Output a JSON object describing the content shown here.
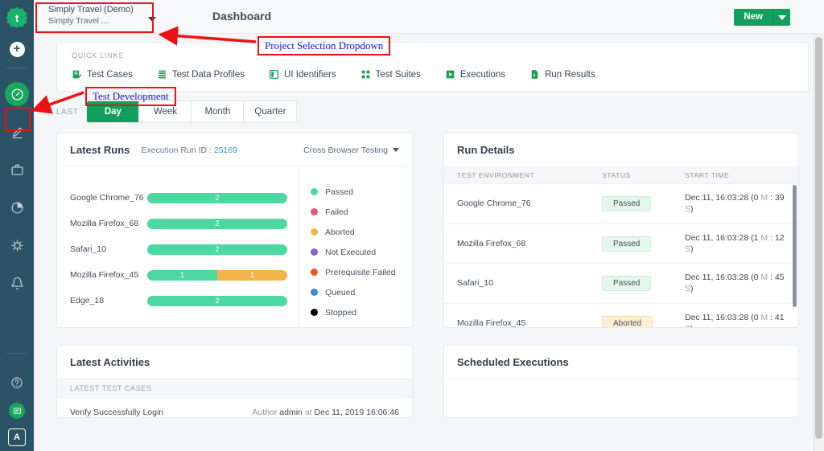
{
  "rail": {
    "logo_icon": "gear-logo-icon",
    "logo_letter": "t",
    "add_icon": "plus-icon",
    "items": [
      {
        "icon": "speedometer-dashboard-icon",
        "name": "dashboard",
        "active": true
      },
      {
        "icon": "pencil-edit-icon",
        "name": "test-development",
        "active": false
      },
      {
        "icon": "briefcase-icon",
        "name": "test-lab",
        "active": false
      },
      {
        "icon": "pie-chart-icon",
        "name": "reports",
        "active": false
      },
      {
        "icon": "bug-settings-icon",
        "name": "defects",
        "active": false
      },
      {
        "icon": "bell-icon",
        "name": "notifications",
        "active": false
      }
    ],
    "bottom": [
      {
        "icon": "help-question-icon",
        "name": "help"
      },
      {
        "icon": "chat-message-icon",
        "name": "messages"
      }
    ],
    "avatar_letter": "A"
  },
  "topbar": {
    "project_name": "Simply Travel (Demo)",
    "project_sub": "Simply Travel ...",
    "caret_icon": "chevron-down-icon",
    "page_title": "Dashboard",
    "new_label": "New",
    "new_caret_icon": "chevron-down-icon"
  },
  "quick_links": {
    "title": "QUICK LINKS",
    "items": [
      {
        "label": "Test Cases",
        "icon": "test-cases-icon"
      },
      {
        "label": "Test Data Profiles",
        "icon": "test-data-profiles-icon"
      },
      {
        "label": "UI Identifiers",
        "icon": "ui-identifiers-icon"
      },
      {
        "label": "Test Suites",
        "icon": "test-suites-icon"
      },
      {
        "label": "Executions",
        "icon": "executions-icon"
      },
      {
        "label": "Run Results",
        "icon": "run-results-icon"
      }
    ]
  },
  "period": {
    "label": "LAST",
    "options": [
      "Day",
      "Week",
      "Month",
      "Quarter"
    ],
    "selected": "Day"
  },
  "latest_runs": {
    "title": "Latest Runs",
    "run_id_label": "Execution Run ID :",
    "run_id_value": "25169",
    "filter_label": "Cross Browser Testing",
    "filter_caret_icon": "chevron-down-icon",
    "legend": [
      {
        "label": "Passed",
        "color": "#4CD8A0"
      },
      {
        "label": "Failed",
        "color": "#E4566E"
      },
      {
        "label": "Aborted",
        "color": "#F0B44A"
      },
      {
        "label": "Not Executed",
        "color": "#8761D6"
      },
      {
        "label": "Prerequisite Failed",
        "color": "#F4511E"
      },
      {
        "label": "Queued",
        "color": "#3B8EDE"
      },
      {
        "label": "Stopped",
        "color": "#000000"
      }
    ]
  },
  "chart_data": {
    "type": "bar",
    "title": "Latest Runs",
    "orientation": "horizontal",
    "stacked": true,
    "categories": [
      "Google Chrome_76",
      "Mozilla Firefox_68",
      "Safari_10",
      "Mozilla Firefox_45",
      "Edge_18"
    ],
    "series": [
      {
        "name": "Passed",
        "color": "#4CD8A0",
        "values": [
          2,
          2,
          2,
          1,
          2
        ]
      },
      {
        "name": "Failed",
        "color": "#E4566E",
        "values": [
          0,
          0,
          0,
          0,
          0
        ]
      },
      {
        "name": "Aborted",
        "color": "#F0B44A",
        "values": [
          0,
          0,
          0,
          1,
          0
        ]
      },
      {
        "name": "Not Executed",
        "color": "#8761D6",
        "values": [
          0,
          0,
          0,
          0,
          0
        ]
      },
      {
        "name": "Prerequisite Failed",
        "color": "#F4511E",
        "values": [
          0,
          0,
          0,
          0,
          0
        ]
      },
      {
        "name": "Queued",
        "color": "#3B8EDE",
        "values": [
          0,
          0,
          0,
          0,
          0
        ]
      },
      {
        "name": "Stopped",
        "color": "#000000",
        "values": [
          0,
          0,
          0,
          0,
          0
        ]
      }
    ],
    "totals": [
      2,
      2,
      2,
      2,
      2
    ],
    "xlabel": "",
    "ylabel": "",
    "legend_position": "right",
    "grid": false
  },
  "run_details": {
    "title": "Run Details",
    "columns": [
      "TEST ENVIRONMENT",
      "STATUS",
      "START TIME"
    ],
    "rows": [
      {
        "env": "Google Chrome_76",
        "status": "Passed",
        "time_main": "Dec 11, 16:03:28 (0",
        "m": "M",
        "sep": " : ",
        "secs": "39",
        "s": "S",
        "close": ")"
      },
      {
        "env": "Mozilla Firefox_68",
        "status": "Passed",
        "time_main": "Dec 11, 16:03:28 (1",
        "m": "M",
        "sep": " : ",
        "secs": "12",
        "s": "S",
        "close": ")"
      },
      {
        "env": "Safari_10",
        "status": "Passed",
        "time_main": "Dec 11, 16:03:28 (0",
        "m": "M",
        "sep": " : ",
        "secs": "45",
        "s": "S",
        "close": ")"
      },
      {
        "env": "Mozilla Firefox_45",
        "status": "Aborted",
        "time_main": "Dec 11, 16:03:28 (0",
        "m": "M",
        "sep": " : ",
        "secs": "41",
        "s": "S",
        "close": ")"
      }
    ]
  },
  "latest_activities": {
    "title": "Latest Activities",
    "subheader": "LATEST TEST CASES",
    "rows": [
      {
        "name": "Verify Successfully Login",
        "author_lbl": "Author",
        "author": "admin",
        "at_lbl": "at",
        "date": "Dec 11, 2019 16:06:46"
      }
    ]
  },
  "scheduled_executions": {
    "title": "Scheduled Executions"
  },
  "annotations": [
    {
      "text": "Project Selection Dropdown",
      "name": "annotation-project-selection-dropdown"
    },
    {
      "text": "Test Development",
      "name": "annotation-test-development"
    }
  ],
  "colors": {
    "brand_green": "#13a05c",
    "rail_bg": "#2b5266",
    "passed_bar": "#4CD8A0",
    "aborted_bar": "#F0B44A",
    "annotation_text": "#1414cd",
    "annotation_box": "#ee1111"
  }
}
